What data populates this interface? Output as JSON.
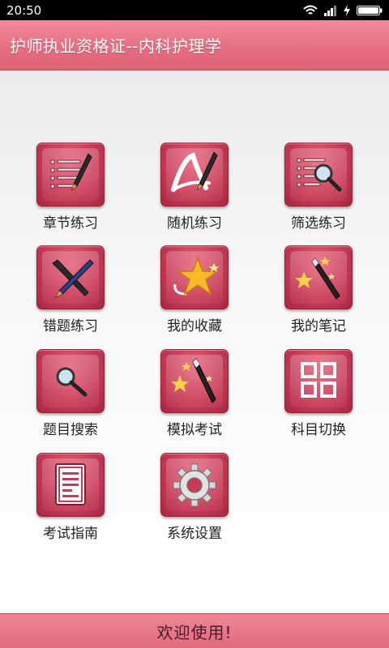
{
  "status_bar": {
    "time": "20:50"
  },
  "header": {
    "title": "护师执业资格证--内科护理学"
  },
  "menu": [
    {
      "label": "章节练习",
      "icon": "list-pen-icon"
    },
    {
      "label": "随机练习",
      "icon": "pen-swoosh-icon"
    },
    {
      "label": "筛选练习",
      "icon": "list-magnifier-icon"
    },
    {
      "label": "错题练习",
      "icon": "cross-pens-icon"
    },
    {
      "label": "我的收藏",
      "icon": "star-icon"
    },
    {
      "label": "我的笔记",
      "icon": "magic-wand-icon"
    },
    {
      "label": "题目搜索",
      "icon": "magnifier-icon"
    },
    {
      "label": "模拟考试",
      "icon": "magic-wand-icon"
    },
    {
      "label": "科目切换",
      "icon": "grid-icon"
    },
    {
      "label": "考试指南",
      "icon": "document-icon"
    },
    {
      "label": "系统设置",
      "icon": "gear-icon"
    }
  ],
  "footer": {
    "text": "欢迎使用!"
  },
  "colors": {
    "accent": "#e56c80",
    "tile": "#c83a55"
  }
}
